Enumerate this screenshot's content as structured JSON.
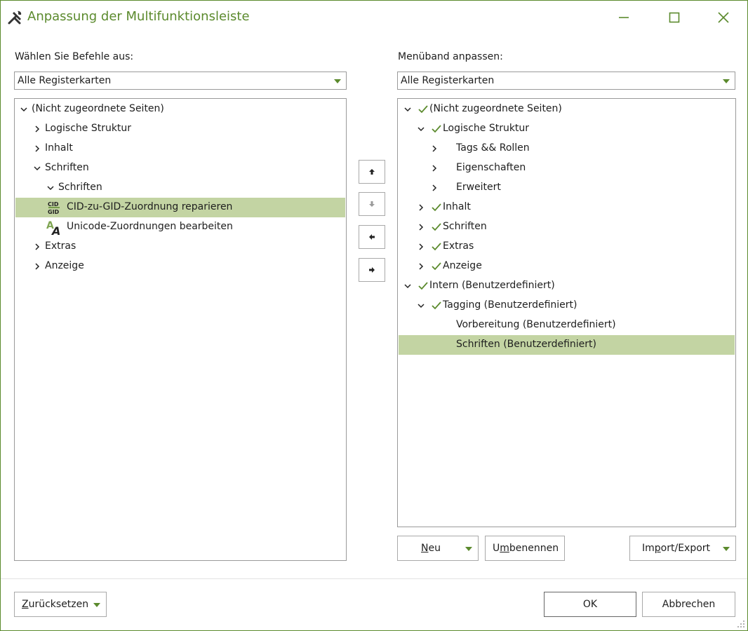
{
  "window": {
    "title": "Anpassung der Multifunktionsleiste",
    "accent_color": "#5b8a2d",
    "selection_color": "#c3d4a3",
    "controls": [
      "minimize-icon",
      "maximize-icon",
      "close-icon"
    ]
  },
  "left": {
    "label": "Wählen Sie Befehle aus:",
    "combo_value": "Alle Registerkarten",
    "tree": [
      {
        "label": "(Nicht zugeordnete Seiten)",
        "level": 0,
        "expander": "expanded",
        "checked": false,
        "selected": false
      },
      {
        "label": "Logische Struktur",
        "level": 1,
        "expander": "collapsed",
        "checked": false,
        "selected": false
      },
      {
        "label": "Inhalt",
        "level": 1,
        "expander": "collapsed",
        "checked": false,
        "selected": false
      },
      {
        "label": "Schriften",
        "level": 1,
        "expander": "expanded",
        "checked": false,
        "selected": false
      },
      {
        "label": "Schriften",
        "level": 2,
        "expander": "expanded",
        "checked": false,
        "selected": false
      },
      {
        "label": "CID-zu-GID-Zuordnung reparieren",
        "level": 3,
        "expander": "none",
        "icon": "cid-gid-icon",
        "icon_text_top": "CID",
        "icon_text_bottom": "GID",
        "checked": false,
        "selected": true
      },
      {
        "label": "Unicode-Zuordnungen bearbeiten",
        "level": 3,
        "expander": "none",
        "icon": "unicode-mapping-icon",
        "icon_text_a": "A",
        "icon_text_b": "A",
        "checked": false,
        "selected": false
      },
      {
        "label": "Extras",
        "level": 1,
        "expander": "collapsed",
        "checked": false,
        "selected": false
      },
      {
        "label": "Anzeige",
        "level": 1,
        "expander": "collapsed",
        "checked": false,
        "selected": false
      }
    ]
  },
  "move_buttons": [
    {
      "name": "move-up-button",
      "icon": "arrow-up-icon",
      "enabled": true
    },
    {
      "name": "move-down-button",
      "icon": "arrow-down-icon",
      "enabled": false
    },
    {
      "name": "remove-button",
      "icon": "arrow-left-icon",
      "enabled": true
    },
    {
      "name": "add-button",
      "icon": "arrow-right-icon",
      "enabled": true
    }
  ],
  "right": {
    "label": "Menüband anpassen:",
    "combo_value": "Alle Registerkarten",
    "tree": [
      {
        "label": "(Nicht zugeordnete Seiten)",
        "level": 0,
        "expander": "expanded",
        "checked": true,
        "selected": false
      },
      {
        "label": "Logische Struktur",
        "level": 1,
        "expander": "expanded",
        "checked": true,
        "selected": false
      },
      {
        "label": "Tags && Rollen",
        "level": 2,
        "expander": "collapsed",
        "checked": false,
        "selected": false
      },
      {
        "label": "Eigenschaften",
        "level": 2,
        "expander": "collapsed",
        "checked": false,
        "selected": false
      },
      {
        "label": "Erweitert",
        "level": 2,
        "expander": "collapsed",
        "checked": false,
        "selected": false
      },
      {
        "label": "Inhalt",
        "level": 1,
        "expander": "collapsed",
        "checked": true,
        "selected": false
      },
      {
        "label": "Schriften",
        "level": 1,
        "expander": "collapsed",
        "checked": true,
        "selected": false
      },
      {
        "label": "Extras",
        "level": 1,
        "expander": "collapsed",
        "checked": true,
        "selected": false
      },
      {
        "label": "Anzeige",
        "level": 1,
        "expander": "collapsed",
        "checked": true,
        "selected": false
      },
      {
        "label": "Intern (Benutzerdefiniert)",
        "level": 0,
        "expander": "expanded",
        "checked": true,
        "selected": false
      },
      {
        "label": "Tagging (Benutzerdefiniert)",
        "level": 1,
        "expander": "expanded",
        "checked": true,
        "selected": false
      },
      {
        "label": "Vorbereitung (Benutzerdefiniert)",
        "level": 2,
        "expander": "none",
        "checked": false,
        "selected": false
      },
      {
        "label": "Schriften (Benutzerdefiniert)",
        "level": 2,
        "expander": "none",
        "checked": false,
        "selected": true
      }
    ],
    "buttons": {
      "new": {
        "label": "Neu",
        "mnemonic": "N"
      },
      "rename": {
        "label": "Umbenennen",
        "mnemonic": "m"
      },
      "import_export": {
        "label": "Import/Export",
        "mnemonic": "p"
      }
    }
  },
  "footer": {
    "reset": {
      "label": "Zurücksetzen",
      "mnemonic": "Z"
    },
    "ok": "OK",
    "cancel": "Abbrechen"
  }
}
